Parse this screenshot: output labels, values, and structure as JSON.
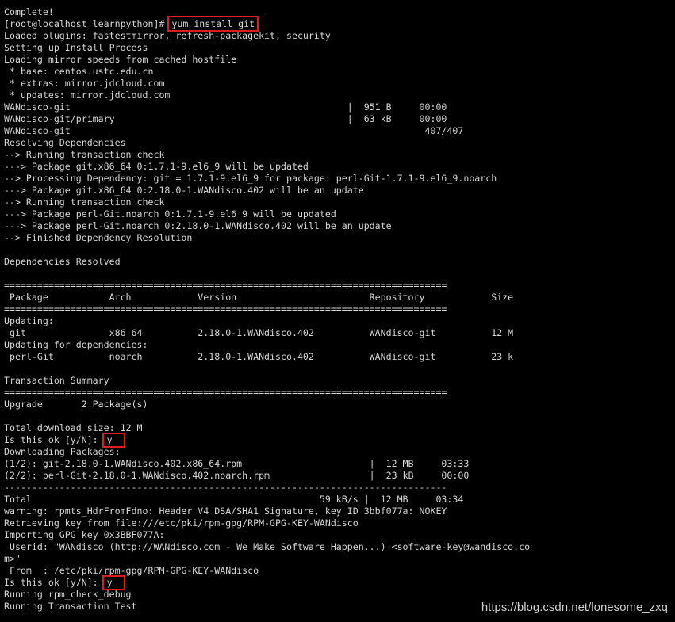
{
  "terminal": {
    "lines": [
      "",
      "Complete!",
      {
        "prefix": "[root@localhost learnpython]# ",
        "highlight": "yum install git",
        "kind": "command"
      },
      "Loaded plugins: fastestmirror, refresh-packagekit, security",
      "Setting up Install Process",
      "Loading mirror speeds from cached hostfile",
      " * base: centos.ustc.edu.cn",
      " * extras: mirror.jdcloud.com",
      " * updates: mirror.jdcloud.com",
      "WANdisco-git                                                  |  951 B     00:00",
      "WANdisco-git/primary                                          |  63 kB     00:00",
      "WANdisco-git                                                                407/407",
      "Resolving Dependencies",
      "--> Running transaction check",
      "---> Package git.x86_64 0:1.7.1-9.el6_9 will be updated",
      "--> Processing Dependency: git = 1.7.1-9.el6_9 for package: perl-Git-1.7.1-9.el6_9.noarch",
      "---> Package git.x86_64 0:2.18.0-1.WANdisco.402 will be an update",
      "--> Running transaction check",
      "---> Package perl-Git.noarch 0:1.7.1-9.el6_9 will be updated",
      "---> Package perl-Git.noarch 0:2.18.0-1.WANdisco.402 will be an update",
      "--> Finished Dependency Resolution",
      "",
      "Dependencies Resolved",
      "",
      "================================================================================",
      " Package           Arch            Version                        Repository            Size",
      "================================================================================",
      "Updating:",
      " git               x86_64          2.18.0-1.WANdisco.402          WANdisco-git          12 M",
      "Updating for dependencies:",
      " perl-Git          noarch          2.18.0-1.WANdisco.402          WANdisco-git          23 k",
      "",
      "Transaction Summary",
      "================================================================================",
      "Upgrade       2 Package(s)",
      "",
      "Total download size: 12 M",
      {
        "prefix": "Is this ok [y/N]: ",
        "highlight": "y",
        "kind": "answer"
      },
      "Downloading Packages:",
      "(1/2): git-2.18.0-1.WANdisco.402.x86_64.rpm                       |  12 MB     03:33",
      "(2/2): perl-Git-2.18.0-1.WANdisco.402.noarch.rpm                  |  23 kB     00:00",
      "--------------------------------------------------------------------------------",
      "Total                                                    59 kB/s |  12 MB     03:34",
      "warning: rpmts_HdrFromFdno: Header V4 DSA/SHA1 Signature, key ID 3bbf077a: NOKEY",
      "Retrieving key from file:///etc/pki/rpm-gpg/RPM-GPG-KEY-WANdisco",
      "Importing GPG key 0x3BBF077A:",
      " Userid: \"WANdisco (http://WANdisco.com - We Make Software Happen...) <software-key@wandisco.co",
      "m>\"",
      " From  : /etc/pki/rpm-gpg/RPM-GPG-KEY-WANdisco",
      {
        "prefix": "Is this ok [y/N]: ",
        "highlight": "y",
        "kind": "answer"
      },
      "Running rpm_check_debug",
      "Running Transaction Test"
    ]
  },
  "watermark": "https://blog.csdn.net/lonesome_zxq",
  "colors": {
    "background": "#000000",
    "text": "#d6d6d6",
    "highlight_box": "#e01b1b"
  }
}
